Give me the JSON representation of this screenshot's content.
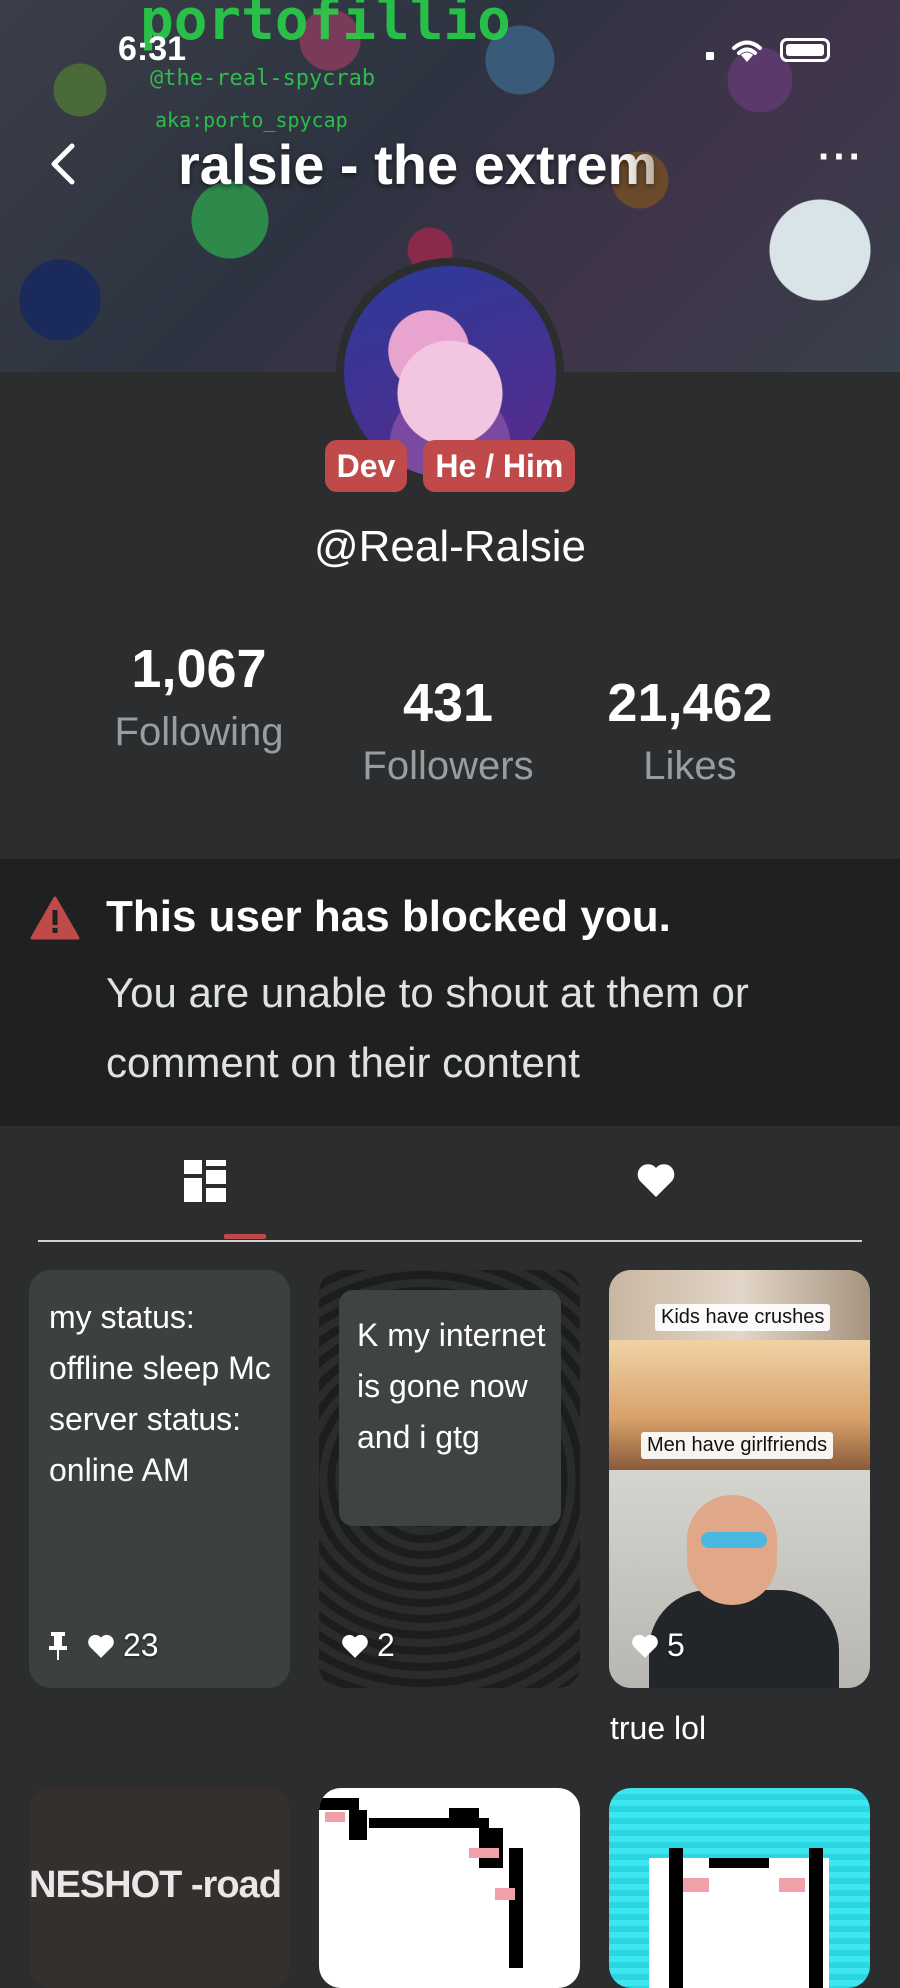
{
  "status_bar": {
    "time": "6:31"
  },
  "banner": {
    "text_line1": "portofillio",
    "text_line2": "@the-real-spycrab",
    "text_line3": "aka:porto_spycap"
  },
  "header": {
    "title": "ralsie - the extrem",
    "more_label": "···"
  },
  "profile": {
    "badges": [
      "Dev",
      "He / Him"
    ],
    "username": "@Real-Ralsie",
    "stats": {
      "following": {
        "value": "1,067",
        "label": "Following"
      },
      "followers": {
        "value": "431",
        "label": "Followers"
      },
      "likes": {
        "value": "21,462",
        "label": "Likes"
      }
    }
  },
  "blocked_notice": {
    "title": "This user has blocked you.",
    "body": "You are unable to shout at them or comment on their content"
  },
  "tabs": [
    {
      "name": "posts",
      "icon": "grid-icon",
      "active": true
    },
    {
      "name": "liked",
      "icon": "heart-icon",
      "active": false
    }
  ],
  "posts": [
    {
      "text": "my status: offline sleep Mc server status: online AM",
      "likes": "23",
      "pinned": true
    },
    {
      "text": "K my internet is gone now and i gtg",
      "likes": "2"
    },
    {
      "captions": [
        "Kids have crushes",
        "Men have girlfriends"
      ],
      "likes": "5",
      "title": "true lol"
    },
    {
      "text": "NESHOT -road"
    }
  ],
  "colors": {
    "accent": "#c04a4a",
    "background": "#2b2d2e",
    "notice_bg": "#1e2021"
  }
}
